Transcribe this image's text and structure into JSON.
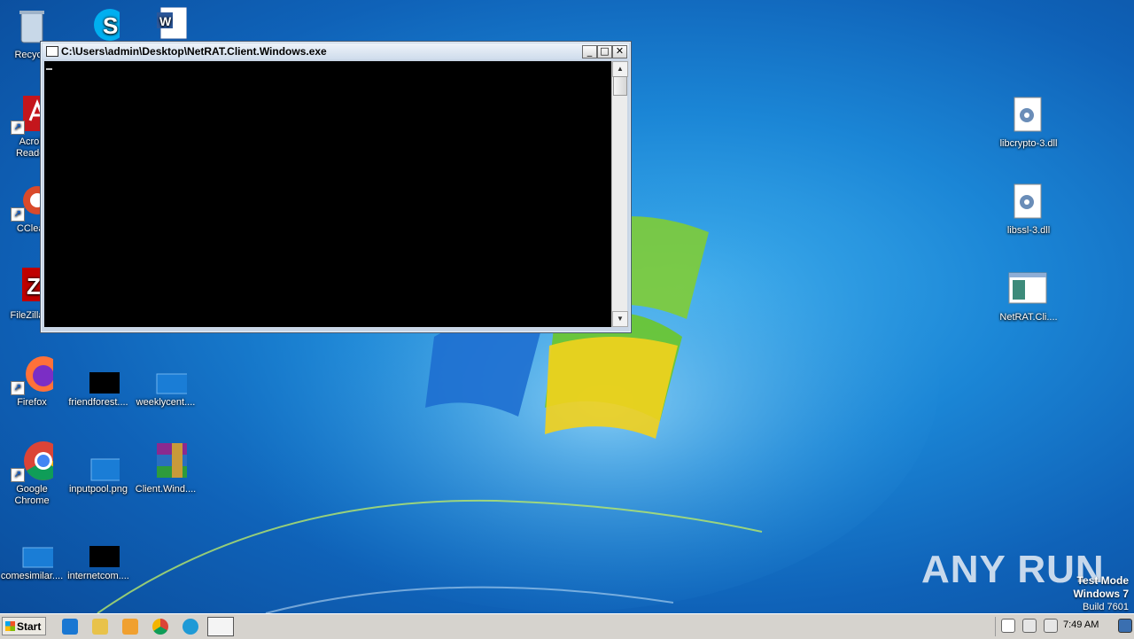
{
  "desktop": {
    "left_icons": [
      {
        "label": "Recycle",
        "icon": "recycle-bin-icon"
      },
      {
        "label": "Acrob\nReader",
        "icon": "acrobat-icon"
      },
      {
        "label": "CClear",
        "icon": "ccleaner-icon"
      },
      {
        "label": "FileZilla C",
        "icon": "filezilla-icon"
      },
      {
        "label": "Firefox",
        "icon": "firefox-icon"
      },
      {
        "label": "Google Chrome",
        "icon": "chrome-icon"
      },
      {
        "label": "comesimilar....",
        "icon": "file-thumbnail-icon"
      }
    ],
    "middle_icons": [
      {
        "label": "friendforest....",
        "icon": "black-thumbnail-icon"
      },
      {
        "label": "inputpool.png",
        "icon": "png-thumbnail-icon"
      },
      {
        "label": "internetcom....",
        "icon": "black-thumbnail-icon"
      }
    ],
    "third_icons": [
      {
        "label": "weeklycent....",
        "icon": "file-thumbnail-icon"
      },
      {
        "label": "Client.Wind....",
        "icon": "winrar-icon"
      }
    ],
    "top_icons": [
      {
        "label": "",
        "icon": "skype-icon"
      },
      {
        "label": "",
        "icon": "word-icon"
      }
    ],
    "right_icons": [
      {
        "label": "libcrypto-3.dll",
        "icon": "dll-icon"
      },
      {
        "label": "libssl-3.dll",
        "icon": "dll-icon"
      },
      {
        "label": "NetRAT.Cli....",
        "icon": "exe-icon"
      }
    ]
  },
  "console_window": {
    "title": "C:\\Users\\admin\\Desktop\\NetRAT.Client.Windows.exe",
    "minimize": "_",
    "maximize": "□",
    "close": "✕"
  },
  "taskbar": {
    "start_label": "Start",
    "clock": "7:49 AM"
  },
  "watermark": "ANY RUN",
  "test_mode": {
    "line1": "Test Mode",
    "line2": "Windows 7",
    "line3": "Build 7601"
  }
}
